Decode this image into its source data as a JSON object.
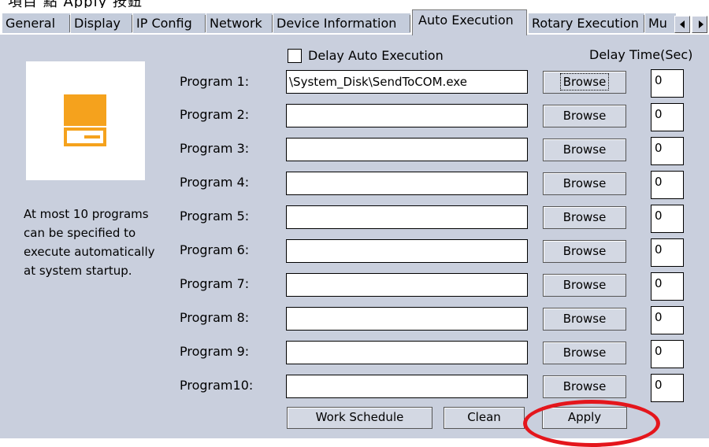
{
  "top_snippet": "項目 點 Apply 按鈕",
  "tabs": [
    "General",
    "Display",
    "IP Config",
    "Network",
    "Device Information",
    "Auto Execution",
    "Rotary Execution",
    "Mu"
  ],
  "description": [
    "At most 10 programs",
    "can be specified to",
    "execute automatically",
    "at system startup."
  ],
  "delay_auto_execution_label": "Delay Auto Execution",
  "delay_time_label": "Delay Time(Sec)",
  "programs": [
    {
      "label": "Program 1:",
      "path": "\\System_Disk\\SendToCOM.exe",
      "browse": "Browse",
      "delay": "0"
    },
    {
      "label": "Program 2:",
      "path": "",
      "browse": "Browse",
      "delay": "0"
    },
    {
      "label": "Program 3:",
      "path": "",
      "browse": "Browse",
      "delay": "0"
    },
    {
      "label": "Program 4:",
      "path": "",
      "browse": "Browse",
      "delay": "0"
    },
    {
      "label": "Program 5:",
      "path": "",
      "browse": "Browse",
      "delay": "0"
    },
    {
      "label": "Program 6:",
      "path": "",
      "browse": "Browse",
      "delay": "0"
    },
    {
      "label": "Program 7:",
      "path": "",
      "browse": "Browse",
      "delay": "0"
    },
    {
      "label": "Program 8:",
      "path": "",
      "browse": "Browse",
      "delay": "0"
    },
    {
      "label": "Program 9:",
      "path": "",
      "browse": "Browse",
      "delay": "0"
    },
    {
      "label": "Program10:",
      "path": "",
      "browse": "Browse",
      "delay": "0"
    }
  ],
  "buttons": {
    "work_schedule": "Work Schedule",
    "clean": "Clean",
    "apply": "Apply"
  },
  "colors": {
    "panel": "#c9cfdd",
    "accent_orange": "#f5a21d",
    "highlight_ring": "#e4161c"
  }
}
